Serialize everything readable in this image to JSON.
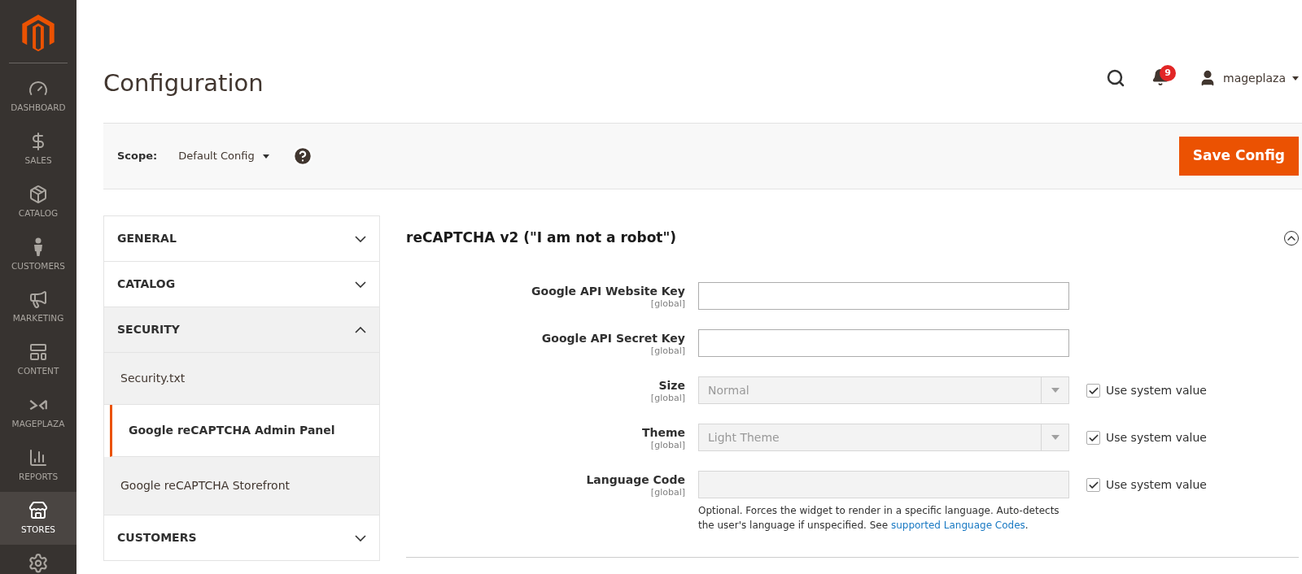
{
  "nav": [
    {
      "label": "DASHBOARD",
      "selected": false
    },
    {
      "label": "SALES",
      "selected": false
    },
    {
      "label": "CATALOG",
      "selected": false
    },
    {
      "label": "CUSTOMERS",
      "selected": false
    },
    {
      "label": "MARKETING",
      "selected": false
    },
    {
      "label": "CONTENT",
      "selected": false
    },
    {
      "label": "MAGEPLAZA",
      "selected": false
    },
    {
      "label": "REPORTS",
      "selected": false
    },
    {
      "label": "STORES",
      "selected": true
    }
  ],
  "page_title": "Configuration",
  "notifications": {
    "count": "9"
  },
  "user": {
    "name": "mageplaza"
  },
  "scope": {
    "label": "Scope:",
    "value": "Default Config"
  },
  "save_button": "Save Config",
  "sections": [
    {
      "label": "GENERAL",
      "expanded": false
    },
    {
      "label": "CATALOG",
      "expanded": false
    },
    {
      "label": "SECURITY",
      "expanded": true,
      "children": [
        {
          "label": "Security.txt",
          "selected": false
        },
        {
          "label": "Google reCAPTCHA Admin Panel",
          "selected": true
        },
        {
          "label": "Google reCAPTCHA Storefront",
          "selected": false
        }
      ]
    },
    {
      "label": "CUSTOMERS",
      "expanded": false
    }
  ],
  "group": {
    "title": "reCAPTCHA v2 (\"I am not a robot\")",
    "expanded": true,
    "fields": [
      {
        "kind": "text",
        "label": "Google API Website Key",
        "scope": "[global]",
        "disabled": false
      },
      {
        "kind": "text",
        "label": "Google API Secret Key",
        "scope": "[global]",
        "disabled": false
      },
      {
        "kind": "select",
        "label": "Size",
        "scope": "[global]",
        "value": "Normal",
        "disabled": true,
        "use_system": {
          "label": "Use system value",
          "checked": true
        }
      },
      {
        "kind": "select",
        "label": "Theme",
        "scope": "[global]",
        "value": "Light Theme",
        "disabled": true,
        "use_system": {
          "label": "Use system value",
          "checked": true
        }
      },
      {
        "kind": "text",
        "label": "Language Code",
        "scope": "[global]",
        "disabled": true,
        "use_system": {
          "label": "Use system value",
          "checked": true
        },
        "note": {
          "text": "Optional. Forces the widget to render in a specific language. Auto-detects the user's language if unspecified. See",
          "link": "supported Language Codes",
          "after": "."
        }
      }
    ]
  }
}
